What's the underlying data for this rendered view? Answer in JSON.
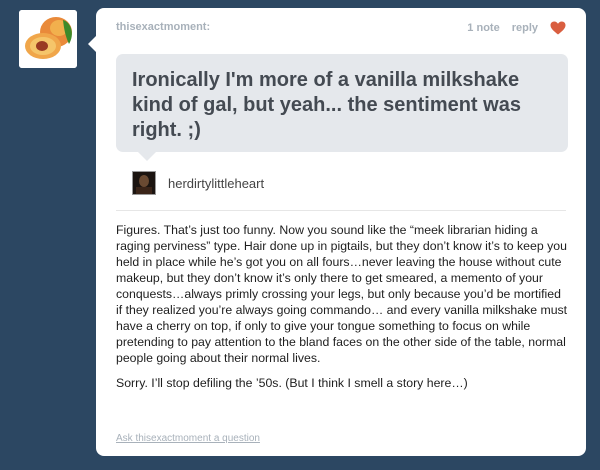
{
  "post": {
    "author": "thisexactmoment:",
    "notes": "1 note",
    "reply_label": "reply",
    "like_icon": "heart-icon",
    "like_color": "#d95e40"
  },
  "question": {
    "text": "Ironically I'm more of a vanilla milkshake kind of gal, but yeah... the sentiment was right. ;)",
    "asker": "herdirtylittleheart"
  },
  "answer": {
    "paragraph1": "Figures. That’s just too funny. Now you sound like the “meek librarian hiding a raging perviness” type. Hair done up in pigtails, but they don’t know it’s to keep you held in place while he’s got you on all fours…never leaving the house without cute makeup, but they don’t know it’s only there to get smeared, a memento of your conquests…always primly crossing your legs, but only because you’d be mortified if they realized you’re always going commando… and every vanilla milkshake must have a cherry on top, if only to give your tongue something to focus on while pretending to pay attention to the bland faces on the other side of the table, normal people going about their normal lives.",
    "paragraph2": "Sorry. I’ll stop defiling the ’50s. (But I think I smell a story here…)"
  },
  "footer": {
    "ask_link": "Ask thisexactmoment a question"
  },
  "colors": {
    "background": "#2c4762",
    "bubble": "#e5e8ec"
  }
}
